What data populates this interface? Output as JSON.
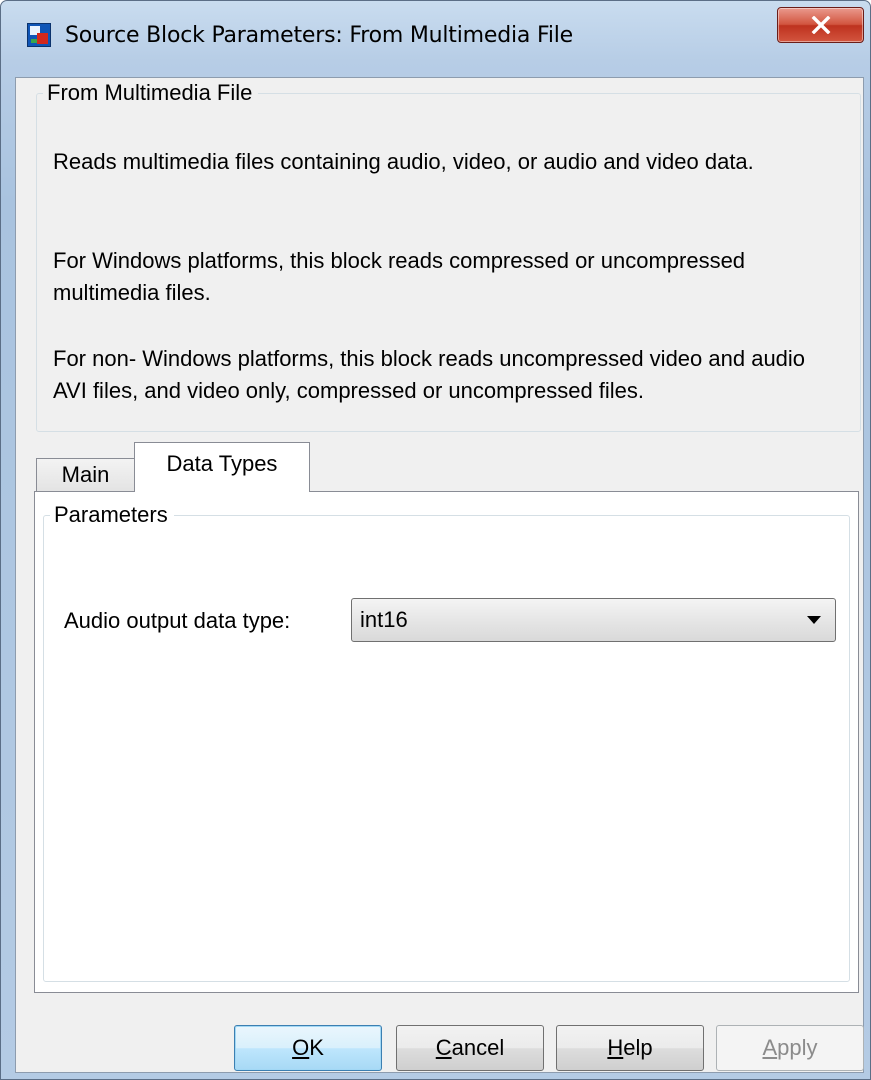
{
  "window": {
    "title": "Source Block Parameters: From Multimedia File"
  },
  "description_group": {
    "legend": "From Multimedia File",
    "paragraphs": [
      "Reads multimedia files containing audio, video, or audio and video data.",
      "For Windows platforms, this block reads compressed or uncompressed multimedia files.",
      "For non- Windows platforms, this block reads uncompressed video and audio AVI files, and video only, compressed or uncompressed files."
    ]
  },
  "tabs": [
    {
      "label": "Main",
      "selected": false
    },
    {
      "label": "Data Types",
      "selected": true
    }
  ],
  "parameters": {
    "legend": "Parameters",
    "audio_output_label": "Audio output data type:",
    "audio_output_value": "int16"
  },
  "buttons": {
    "ok": {
      "mnemonic": "O",
      "rest": "K"
    },
    "cancel": {
      "mnemonic": "C",
      "rest": "ancel"
    },
    "help": {
      "mnemonic": "H",
      "rest": "elp"
    },
    "apply": {
      "mnemonic": "A",
      "rest": "pply",
      "enabled": false
    }
  },
  "icons": {
    "app": "simulink-block-icon",
    "close": "close-icon",
    "dropdown": "chevron-down-icon"
  },
  "colors": {
    "close_button": "#c9432f",
    "ok_border": "#3c7fb1",
    "dialog_background": "#f0f0f0"
  }
}
